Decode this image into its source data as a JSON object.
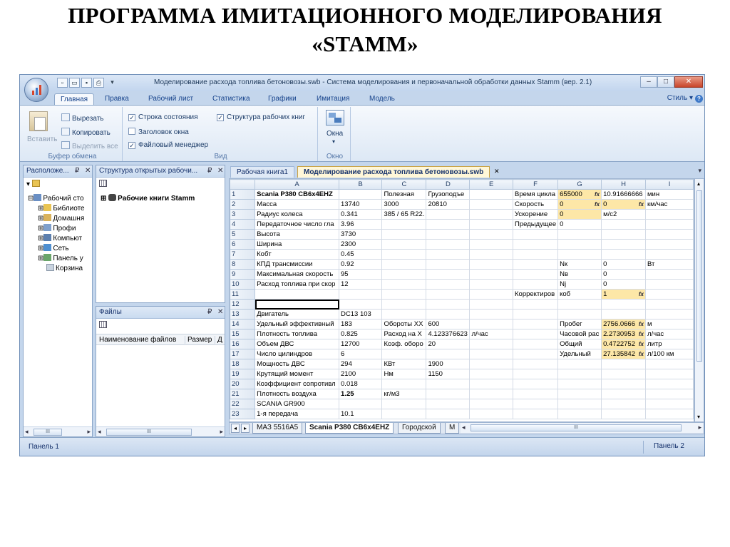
{
  "slide": {
    "title_line1": "ПРОГРАММА ИМИТАЦИОННОГО МОДЕЛИРОВАНИЯ",
    "title_line2": "«STAMM»"
  },
  "window": {
    "title": "Моделирование расхода топлива бетоновозы.swb - Система моделирования и первоначальной обработки данных Stamm (вер. 2.1)",
    "minimize": "–",
    "maximize": "□",
    "close": "✕"
  },
  "ribbon": {
    "tabs": [
      "Главная",
      "Правка",
      "Рабочий лист",
      "Статистика",
      "Графики",
      "Имитация",
      "Модель"
    ],
    "style_label": "Стиль",
    "help": "?",
    "clipboard": {
      "paste": "Вставить",
      "cut": "Вырезать",
      "copy": "Копировать",
      "select_all": "Выделить все",
      "caption": "Буфер обмена"
    },
    "view": {
      "status_bar": "Строка состояния",
      "window_title": "Заголовок окна",
      "file_manager": "Файловый менеджер",
      "workbook_structure": "Структура рабочих книг",
      "caption": "Вид"
    },
    "window_group": {
      "windows": "Окна",
      "caption": "Окно"
    }
  },
  "panels": {
    "location": {
      "title": "Расположе...",
      "pin": "₽",
      "close": "✕",
      "tree": [
        "Рабочий сто",
        "Библиоте",
        "Домашня",
        "Профи",
        "Компьют",
        "Сеть",
        "Панель у",
        "Корзина"
      ]
    },
    "structure": {
      "title": "Структура открытых рабочи...",
      "pin": "₽",
      "close": "✕",
      "item": "Рабочие книги Stamm"
    },
    "files": {
      "title": "Файлы",
      "pin": "₽",
      "close": "✕",
      "col_name": "Наименование файлов",
      "col_size": "Размер",
      "col_more": "Д"
    }
  },
  "doc_tabs": [
    "Рабочая книга1",
    "Моделирование расхода топлива бетоновозы.swb"
  ],
  "doc_tab_close": "✕",
  "sheet": {
    "columns": [
      "",
      "A",
      "B",
      "C",
      "D",
      "E",
      "F",
      "G",
      "H",
      "I"
    ],
    "rows": [
      [
        "1",
        "Scania P380 CB6x4EHZ",
        "",
        "Полезная",
        "Грузоподъе",
        "",
        "Время цикла",
        "655000",
        "10.91666666",
        "мин"
      ],
      [
        "2",
        "Масса",
        "13740",
        "3000",
        "20810",
        "",
        "Скорость",
        "0",
        "0",
        "км/час"
      ],
      [
        "3",
        "Радиус колеса",
        "0.341",
        "385 / 65 R22.",
        "",
        "",
        "Ускорение",
        "0",
        "м/с2",
        ""
      ],
      [
        "4",
        "Передаточное число гла",
        "3.96",
        "",
        "",
        "",
        "Предыдущее",
        "0",
        "",
        ""
      ],
      [
        "5",
        "Высота",
        "3730",
        "",
        "",
        "",
        "",
        "",
        "",
        ""
      ],
      [
        "6",
        "Ширина",
        "2300",
        "",
        "",
        "",
        "",
        "",
        "",
        ""
      ],
      [
        "7",
        "Кобт",
        "0.45",
        "",
        "",
        "",
        "",
        "",
        "",
        ""
      ],
      [
        "8",
        "КПД трансмиссии",
        "0.92",
        "",
        "",
        "",
        "",
        "Nк",
        "0",
        "Вт"
      ],
      [
        "9",
        "Максимальная скорость",
        "95",
        "",
        "",
        "",
        "",
        "Nв",
        "0",
        ""
      ],
      [
        "10",
        "Расход топлива при скор",
        "12",
        "",
        "",
        "",
        "",
        "Nj",
        "0",
        ""
      ],
      [
        "11",
        "",
        "",
        "",
        "",
        "",
        "Корректиров",
        "коб",
        "1",
        ""
      ],
      [
        "12",
        "",
        "",
        "",
        "",
        "",
        "",
        "",
        "",
        ""
      ],
      [
        "13",
        "Двигатель",
        "DC13 103",
        "",
        "",
        "",
        "",
        "",
        "",
        ""
      ],
      [
        "14",
        "Удельный эффективный",
        "183",
        "Обороты XX",
        "600",
        "",
        "",
        "Пробег",
        "2756.0666",
        "м"
      ],
      [
        "15",
        "Плотность топлива",
        "0.825",
        "Расход на X",
        "4.123376623",
        "л/час",
        "",
        "Часовой рас",
        "2.2730953",
        "л/час"
      ],
      [
        "16",
        "Объем ДВС",
        "12700",
        "Коэф. оборо",
        "20",
        "",
        "",
        "Общий",
        "0.4722752",
        "литр"
      ],
      [
        "17",
        "Число цилиндров",
        "6",
        "",
        "",
        "",
        "",
        "Удельный",
        "27.135842",
        "л/100 км"
      ],
      [
        "18",
        "Мощность ДВС",
        "294",
        "КВт",
        "1900",
        "",
        "",
        "",
        "",
        ""
      ],
      [
        "19",
        "Крутящий момент",
        "2100",
        "Нм",
        "1150",
        "",
        "",
        "",
        "",
        ""
      ],
      [
        "20",
        "Коэффициент сопротивл",
        "0.018",
        "",
        "",
        "",
        "",
        "",
        "",
        ""
      ],
      [
        "21",
        "Плотность воздуха",
        "1.25",
        "кг/м3",
        "",
        "",
        "",
        "",
        "",
        ""
      ],
      [
        "22",
        " SCANIA GR900",
        "",
        "",
        "",
        "",
        "",
        "",
        "",
        ""
      ],
      [
        "23",
        "1-я передача",
        "10.1",
        "",
        "",
        "",
        "",
        "",
        "",
        ""
      ]
    ],
    "fx_label": "fx",
    "sheet_tabs": [
      "МАЗ 5516А5",
      "Scania P380 CB6x4EHZ",
      "Городской",
      "М"
    ]
  },
  "status": {
    "left": "Панель 1",
    "right": "Панель 2"
  }
}
